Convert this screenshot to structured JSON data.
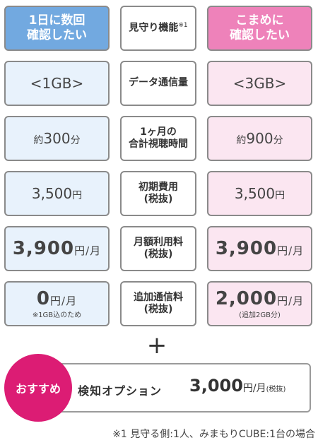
{
  "headers": {
    "left": [
      "1日に数回",
      "確認したい"
    ],
    "middle": "見守り機能",
    "middle_mark": "※1",
    "right": [
      "こまめに",
      "確認したい"
    ]
  },
  "rows": [
    {
      "left": "<1GB>",
      "middle": [
        "データ通信量"
      ],
      "right": "<3GB>"
    },
    {
      "left_prefix": "約",
      "left_value": "300",
      "left_unit": "分",
      "middle": [
        "1ヶ月の",
        "合計視聴時間"
      ],
      "right_prefix": "約",
      "right_value": "900",
      "right_unit": "分"
    },
    {
      "left_value": "3,500",
      "left_unit": "円",
      "middle": [
        "初期費用",
        "(税抜)"
      ],
      "right_value": "3,500",
      "right_unit": "円"
    },
    {
      "left_value": "3,900",
      "left_unit": "円/月",
      "middle": [
        "月額利用料",
        "(税抜)"
      ],
      "right_value": "3,900",
      "right_unit": "円/月"
    },
    {
      "left_value": "0",
      "left_unit": "円/月",
      "left_note": "※1GB込のため",
      "middle": [
        "追加通信料",
        "(税抜)"
      ],
      "right_value": "2,000",
      "right_unit": "円/月",
      "right_note": "(追加2GB分)"
    }
  ],
  "plus": "+",
  "option": {
    "badge": "おすすめ",
    "name": "検知オプション",
    "price": "3,000",
    "unit": "円/月",
    "tax": "(税抜)"
  },
  "footnote": "※1 見守る側:1人、みまもりCUBE:1台の場合",
  "colors": {
    "blue_header": "#72a9e0",
    "pink_header": "#ee82ba",
    "badge": "#dc1c74"
  }
}
